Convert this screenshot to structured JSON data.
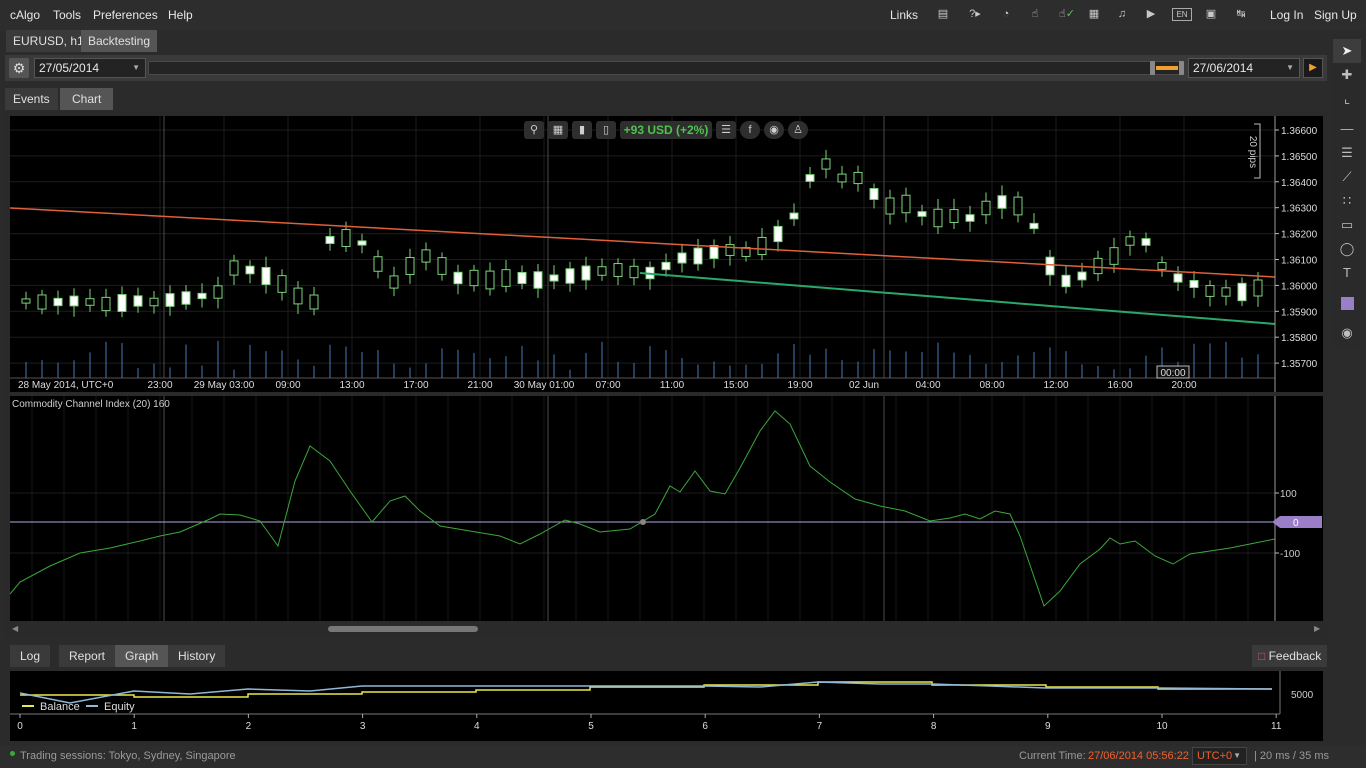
{
  "menu": {
    "items": [
      "cAlgo",
      "Tools",
      "Preferences",
      "Help"
    ],
    "links": "Links",
    "login": "Log In",
    "signup": "Sign Up",
    "lang": "EN"
  },
  "doc_tabs": [
    {
      "label": "EURUSD, h1",
      "active": false
    },
    {
      "label": "Backtesting",
      "active": true
    }
  ],
  "range": {
    "start": "27/05/2014",
    "end": "27/06/2014"
  },
  "view_tabs": [
    {
      "label": "Events",
      "active": false
    },
    {
      "label": "Chart",
      "active": true
    }
  ],
  "chart_overlay": {
    "pnl": "+93 USD (+2%)"
  },
  "price_chart": {
    "scale_label": "20 pips",
    "y_ticks": [
      "1.36600",
      "1.36500",
      "1.36400",
      "1.36300",
      "1.36200",
      "1.36100",
      "1.36000",
      "1.35900",
      "1.35800",
      "1.35700"
    ],
    "x_ticks": [
      "28 May 2014, UTC+0",
      "23:00",
      "29 May 03:00",
      "09:00",
      "13:00",
      "17:00",
      "21:00",
      "30 May 01:00",
      "07:00",
      "11:00",
      "15:00",
      "19:00",
      "02 Jun",
      "04:00",
      "08:00",
      "12:00",
      "16:00",
      "20:00"
    ],
    "cursor_time": "00:00"
  },
  "cci": {
    "title": "Commodity Channel Index (20) 160",
    "levels": [
      "100",
      "0",
      "-100"
    ]
  },
  "bottom_tabs": [
    {
      "label": "Log",
      "active": false
    },
    {
      "label": "Report",
      "active": false
    },
    {
      "label": "Graph",
      "active": true
    },
    {
      "label": "History",
      "active": false
    }
  ],
  "feedback": "Feedback",
  "graph": {
    "legend": [
      "Balance",
      "Equity"
    ],
    "x_ticks": [
      "0",
      "1",
      "2",
      "3",
      "4",
      "5",
      "6",
      "7",
      "8",
      "9",
      "10",
      "11"
    ],
    "y_tick": "5000",
    "colors": {
      "balance": "#e8e84a",
      "equity": "#8fb8d8"
    }
  },
  "status": {
    "sessions": "Trading sessions:  Tokyo, Sydney, Singapore",
    "current_time_label": "Current Time:",
    "current_time": "27/06/2014 05:56:22",
    "tz": "UTC+0",
    "latency": "20 ms / 35 ms"
  }
}
